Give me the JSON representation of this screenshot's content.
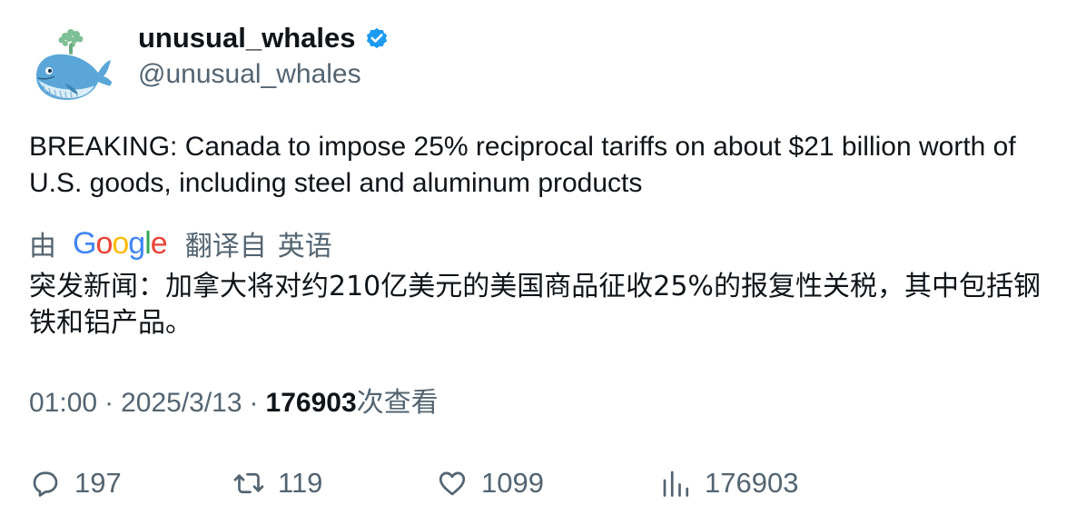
{
  "author": {
    "display_name": "unusual_whales",
    "handle": "@unusual_whales",
    "verified": true,
    "avatar_icon": "whale-avatar-icon",
    "verified_icon": "verified-badge-icon"
  },
  "tweet": {
    "text": "BREAKING: Canada to impose 25% reciprocal tariffs on about $21 billion worth of U.S. goods, including steel and aluminum products"
  },
  "translation": {
    "by_label": "由",
    "provider_letters": [
      "G",
      "o",
      "o",
      "g",
      "l",
      "e"
    ],
    "from_label": "翻译自",
    "language": "英语",
    "text": "突发新闻：加拿大将对约210亿美元的美国商品征收25%的报复性关税，其中包括钢铁和铝产品。"
  },
  "meta": {
    "time": "01:00",
    "separator": "·",
    "date": "2025/3/13",
    "views_count": "176903",
    "views_label": "次查看"
  },
  "actions": {
    "reply_count": "197",
    "retweet_count": "119",
    "like_count": "1099",
    "views_count": "176903"
  },
  "colors": {
    "text_primary": "#0f1419",
    "text_secondary": "#536471",
    "verified_blue": "#1d9bf0",
    "background": "#ffffff"
  }
}
